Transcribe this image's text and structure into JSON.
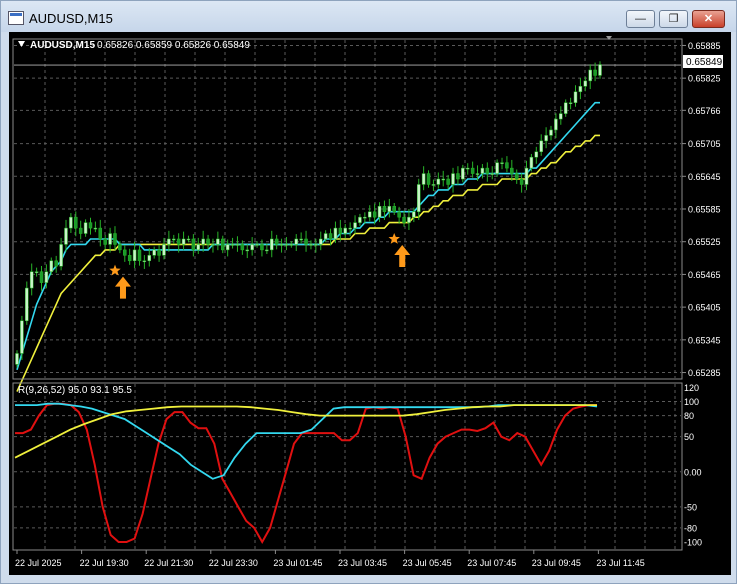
{
  "window": {
    "title": "AUDUSD,M15",
    "minimize_icon": "minimize-icon",
    "restore_icon": "restore-icon",
    "close_icon": "close-icon"
  },
  "chart_header": {
    "collapse_icon": "triangle-down-icon",
    "symbol": "AUDUSD,M15",
    "ohlc": "0.65826 0.65859 0.65826 0.65849"
  },
  "price_axis": {
    "ticks": [
      "0.65885",
      "0.65825",
      "0.65766",
      "0.65705",
      "0.65645",
      "0.65585",
      "0.65525",
      "0.65465",
      "0.65405",
      "0.65345",
      "0.65285"
    ],
    "current_price": "0.65849"
  },
  "indicator": {
    "label": "R(9,26,52) 95.0 93.1 95.5",
    "ticks": [
      "120",
      "100",
      "80",
      "50",
      "0.00",
      "-50",
      "-80",
      "-100"
    ]
  },
  "time_axis": {
    "labels": [
      "22 Jul 2025",
      "22 Jul 19:30",
      "22 Jul 21:30",
      "22 Jul 23:30",
      "23 Jul 01:45",
      "23 Jul 03:45",
      "23 Jul 05:45",
      "23 Jul 07:45",
      "23 Jul 09:45",
      "23 Jul 11:45"
    ]
  },
  "colors": {
    "background": "#000000",
    "grid": "#5a5a5a",
    "bull_candle": "#c8f5c8",
    "bear_candle": "#1a9a2a",
    "wick": "#28b428",
    "fast_ma": "#33d9f0",
    "slow_ma": "#f0f03c",
    "signal_fast": "#33d9f0",
    "signal_slow": "#f0f03c",
    "oscillator": "#e01010",
    "signal_marker": "#ff9a1a",
    "current_price_line": "#b4b4b4"
  },
  "chart_data": [
    {
      "type": "candlestick",
      "title": "AUDUSD,M15",
      "xlabel": "",
      "ylabel": "",
      "ylim": [
        0.65275,
        0.65895
      ],
      "x_range": [
        "22 Jul 2025",
        "23 Jul 11:45"
      ],
      "x_tick_labels": [
        "22 Jul 2025",
        "22 Jul 19:30",
        "22 Jul 21:30",
        "22 Jul 23:30",
        "23 Jul 01:45",
        "23 Jul 03:45",
        "23 Jul 05:45",
        "23 Jul 07:45",
        "23 Jul 09:45",
        "23 Jul 11:45"
      ],
      "grid": true,
      "close_series": [
        0.6532,
        0.6538,
        0.6544,
        0.6547,
        0.6547,
        0.6545,
        0.6547,
        0.6549,
        0.6548,
        0.6552,
        0.6555,
        0.6557,
        0.6555,
        0.6554,
        0.6556,
        0.6555,
        0.6555,
        0.6553,
        0.6552,
        0.6554,
        0.6552,
        0.6551,
        0.655,
        0.6549,
        0.6551,
        0.6549,
        0.6549,
        0.655,
        0.6551,
        0.655,
        0.6552,
        0.6553,
        0.6553,
        0.6552,
        0.6553,
        0.6553,
        0.6551,
        0.6552,
        0.6553,
        0.6552,
        0.6552,
        0.6553,
        0.6551,
        0.6552,
        0.6552,
        0.6552,
        0.6551,
        0.6551,
        0.6552,
        0.6552,
        0.6551,
        0.6551,
        0.6553,
        0.6552,
        0.6552,
        0.6552,
        0.6552,
        0.6553,
        0.6553,
        0.6552,
        0.6552,
        0.6552,
        0.6553,
        0.6554,
        0.6553,
        0.6555,
        0.6554,
        0.6555,
        0.6555,
        0.6556,
        0.6557,
        0.6557,
        0.6558,
        0.6557,
        0.6559,
        0.6558,
        0.6559,
        0.6558,
        0.6557,
        0.6556,
        0.6557,
        0.6558,
        0.6563,
        0.6565,
        0.6563,
        0.6563,
        0.6564,
        0.6564,
        0.6563,
        0.6565,
        0.6564,
        0.6566,
        0.6566,
        0.6565,
        0.6565,
        0.6566,
        0.6565,
        0.6565,
        0.6567,
        0.6567,
        0.6566,
        0.6565,
        0.6564,
        0.6563,
        0.6566,
        0.6568,
        0.6569,
        0.6571,
        0.6572,
        0.6573,
        0.6575,
        0.6576,
        0.6578,
        0.6578,
        0.658,
        0.6581,
        0.6582,
        0.6584,
        0.6583,
        0.6585
      ],
      "fast_ma": [
        0.6529,
        0.6532,
        0.6535,
        0.6538,
        0.6541,
        0.6543,
        0.6545,
        0.6547,
        0.6548,
        0.6549,
        0.6551,
        0.6552,
        0.6552,
        0.6552,
        0.6552,
        0.6553,
        0.6553,
        0.6553,
        0.6553,
        0.6553,
        0.6553,
        0.6552,
        0.6552,
        0.6552,
        0.6552,
        0.6552,
        0.6551,
        0.6551,
        0.6551,
        0.6551,
        0.6551,
        0.6551,
        0.6551,
        0.6551,
        0.6551,
        0.6551,
        0.6551,
        0.6551,
        0.6551,
        0.6551,
        0.6552,
        0.6552,
        0.6552,
        0.6552,
        0.6552,
        0.6552,
        0.6552,
        0.6552,
        0.6552,
        0.6552,
        0.6552,
        0.6552,
        0.6552,
        0.6552,
        0.6552,
        0.6552,
        0.6552,
        0.6552,
        0.6552,
        0.6552,
        0.6552,
        0.6552,
        0.6552,
        0.6553,
        0.6553,
        0.6553,
        0.6554,
        0.6554,
        0.6554,
        0.6555,
        0.6555,
        0.6556,
        0.6556,
        0.6556,
        0.6557,
        0.6557,
        0.6558,
        0.6558,
        0.6558,
        0.6558,
        0.6558,
        0.6558,
        0.6559,
        0.656,
        0.6561,
        0.6561,
        0.6562,
        0.6562,
        0.6562,
        0.6563,
        0.6563,
        0.6563,
        0.6564,
        0.6564,
        0.6564,
        0.6565,
        0.6565,
        0.6565,
        0.6565,
        0.6565,
        0.6565,
        0.6565,
        0.6565,
        0.6565,
        0.6565,
        0.6566,
        0.6566,
        0.6567,
        0.6568,
        0.6569,
        0.657,
        0.6571,
        0.6572,
        0.6573,
        0.6574,
        0.6575,
        0.6576,
        0.6577,
        0.6578,
        0.6578
      ],
      "slow_ma": [
        0.6525,
        0.6527,
        0.6529,
        0.6531,
        0.6533,
        0.6535,
        0.6537,
        0.6539,
        0.6541,
        0.6543,
        0.6544,
        0.6545,
        0.6546,
        0.6547,
        0.6548,
        0.6549,
        0.655,
        0.655,
        0.6551,
        0.6551,
        0.6551,
        0.6552,
        0.6552,
        0.6552,
        0.6552,
        0.6552,
        0.6552,
        0.6552,
        0.6552,
        0.6552,
        0.6552,
        0.6552,
        0.6552,
        0.6552,
        0.6552,
        0.6552,
        0.6552,
        0.6552,
        0.6552,
        0.6552,
        0.6552,
        0.6552,
        0.6552,
        0.6552,
        0.6552,
        0.6552,
        0.6552,
        0.6552,
        0.6552,
        0.6552,
        0.6552,
        0.6552,
        0.6552,
        0.6552,
        0.6552,
        0.6552,
        0.6552,
        0.6552,
        0.6552,
        0.6552,
        0.6552,
        0.6552,
        0.6552,
        0.6552,
        0.6552,
        0.6553,
        0.6553,
        0.6553,
        0.6553,
        0.6554,
        0.6554,
        0.6554,
        0.6555,
        0.6555,
        0.6555,
        0.6555,
        0.6556,
        0.6556,
        0.6556,
        0.6556,
        0.6556,
        0.6557,
        0.6557,
        0.6558,
        0.6558,
        0.6559,
        0.6559,
        0.656,
        0.656,
        0.6561,
        0.6561,
        0.6561,
        0.6562,
        0.6562,
        0.6562,
        0.6563,
        0.6563,
        0.6563,
        0.6563,
        0.6564,
        0.6564,
        0.6564,
        0.6564,
        0.6564,
        0.6564,
        0.6565,
        0.6565,
        0.6566,
        0.6566,
        0.6567,
        0.6567,
        0.6568,
        0.6569,
        0.6569,
        0.657,
        0.657,
        0.6571,
        0.6571,
        0.6572,
        0.6572
      ],
      "signals": [
        {
          "candle_index": 20,
          "price": 0.65472,
          "type": "buy"
        },
        {
          "candle_index": 77,
          "price": 0.6553,
          "type": "buy"
        }
      ],
      "current_price": 0.65849
    },
    {
      "type": "line",
      "title": "R(9,26,52) 95.0 93.1 95.5",
      "ylim": [
        -110,
        125
      ],
      "y_ticks": [
        120,
        100,
        80,
        50,
        0,
        -50,
        -80,
        -100
      ],
      "series": [
        {
          "values": [
            55,
            55,
            60,
            80,
            95,
            97,
            97,
            95,
            85,
            60,
            10,
            -50,
            -90,
            -100,
            -100,
            -95,
            -60,
            -10,
            40,
            75,
            85,
            85,
            70,
            62,
            62,
            40,
            -10,
            -30,
            -50,
            -70,
            -80,
            -100,
            -80,
            -40,
            0,
            40,
            55,
            55,
            55,
            55,
            55,
            45,
            45,
            55,
            90,
            92,
            90,
            92,
            90,
            50,
            -5,
            -10,
            20,
            40,
            50,
            55,
            60,
            60,
            58,
            62,
            70,
            50,
            45,
            55,
            50,
            30,
            10,
            30,
            60,
            80,
            90,
            93,
            95,
            95
          ]
        },
        {
          "values": [
            95,
            95,
            95,
            97,
            97,
            95,
            93,
            90,
            85,
            80,
            75,
            65,
            55,
            45,
            35,
            25,
            10,
            0,
            -10,
            -5,
            20,
            40,
            55,
            55,
            55,
            55,
            55,
            60,
            75,
            90,
            92,
            92,
            92,
            92,
            92,
            92,
            92,
            92,
            92,
            92,
            92,
            92,
            92,
            93,
            95,
            95,
            95,
            95,
            95,
            95,
            95,
            95,
            95,
            93
          ]
        },
        {
          "values": [
            20,
            30,
            40,
            50,
            60,
            68,
            75,
            82,
            86,
            88,
            90,
            92,
            93,
            93,
            93,
            93,
            93,
            92,
            90,
            88,
            85,
            82,
            80,
            80,
            80,
            80,
            80,
            80,
            80,
            82,
            85,
            88,
            90,
            92,
            93,
            93,
            95,
            95,
            95,
            95,
            95,
            95,
            95
          ]
        }
      ]
    }
  ]
}
